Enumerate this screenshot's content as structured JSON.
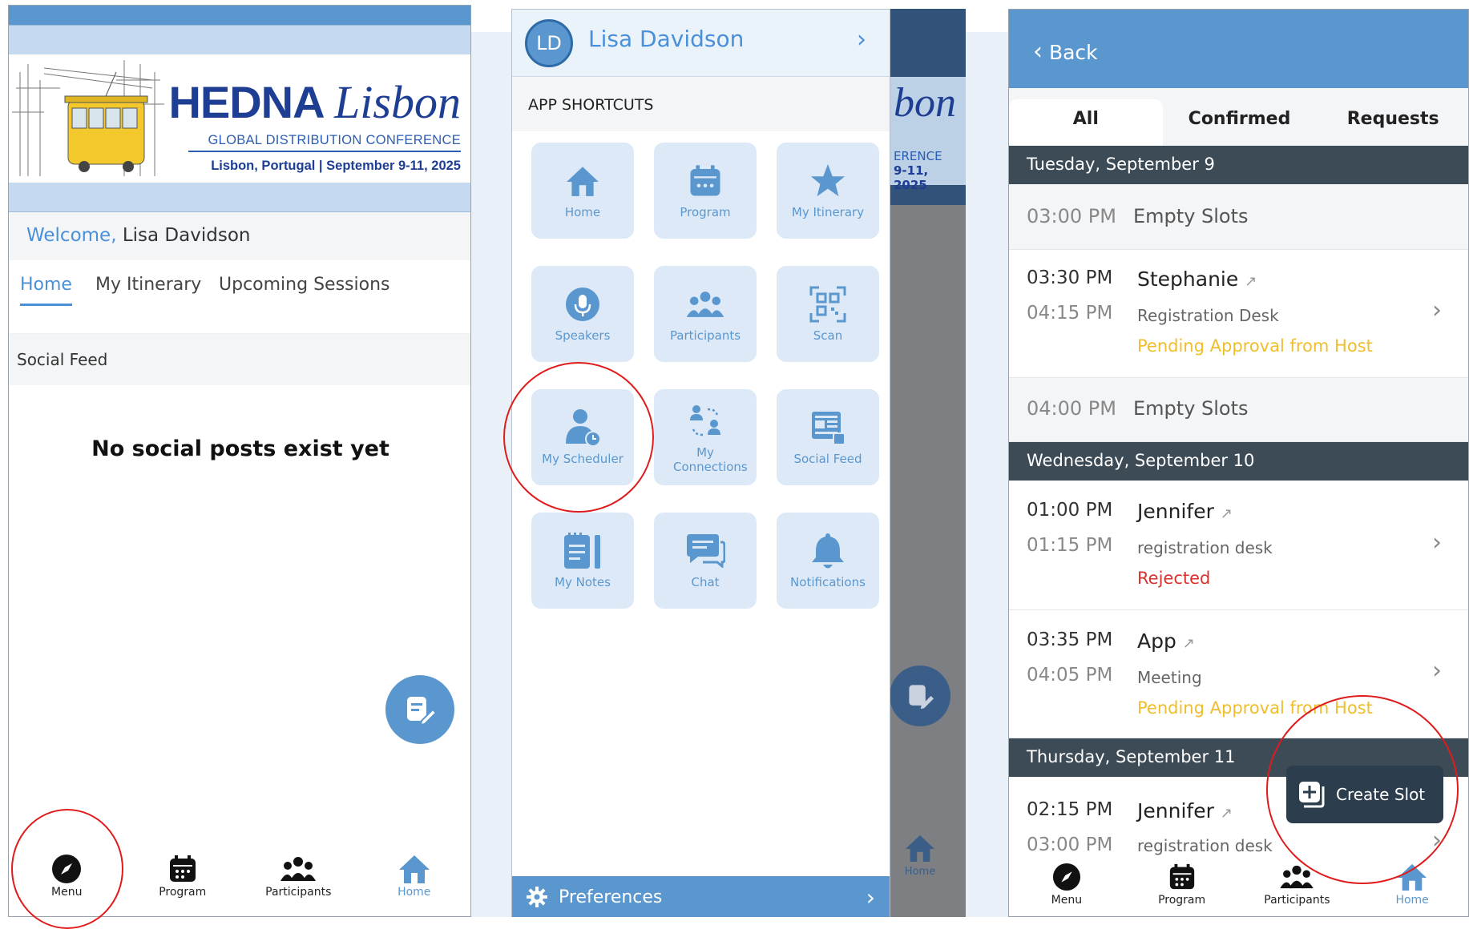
{
  "screen1": {
    "banner": {
      "brand": "HEDNA",
      "city": "Lisbon",
      "subtitle": "GLOBAL DISTRIBUTION CONFERENCE",
      "location_date": "Lisbon, Portugal | September 9-11, 2025"
    },
    "welcome_prefix": "Welcome,",
    "welcome_name": "Lisa Davidson",
    "tabs": [
      "Home",
      "My Itinerary",
      "Upcoming Sessions"
    ],
    "social_feed_label": "Social Feed",
    "empty_message": "No social posts exist yet",
    "nav": [
      "Menu",
      "Program",
      "Participants",
      "Home"
    ]
  },
  "screen2": {
    "avatar_initials": "LD",
    "user_name": "Lisa Davidson",
    "section_title": "APP SHORTCUTS",
    "shortcuts": [
      {
        "label": "Home",
        "icon": "home-icon"
      },
      {
        "label": "Program",
        "icon": "calendar-icon"
      },
      {
        "label": "My Itinerary",
        "icon": "star-icon"
      },
      {
        "label": "Speakers",
        "icon": "microphone-icon"
      },
      {
        "label": "Participants",
        "icon": "people-icon"
      },
      {
        "label": "Scan",
        "icon": "qr-icon"
      },
      {
        "label": "My Scheduler",
        "icon": "person-clock-icon"
      },
      {
        "label": "My Connections",
        "icon": "connections-icon"
      },
      {
        "label": "Social Feed",
        "icon": "social-feed-icon"
      },
      {
        "label": "My Notes",
        "icon": "notes-icon"
      },
      {
        "label": "Chat",
        "icon": "chat-icon"
      },
      {
        "label": "Notifications",
        "icon": "bell-icon"
      }
    ],
    "background_fragment": {
      "city": "bon",
      "subtitle": "ERENCE",
      "date": "9-11, 2025",
      "home": "Home"
    },
    "preferences_label": "Preferences"
  },
  "screen3": {
    "back_label": "Back",
    "tabs": [
      "All",
      "Confirmed",
      "Requests"
    ],
    "days": [
      {
        "header": "Tuesday, September 9"
      },
      {
        "header": "Wednesday, September 10"
      },
      {
        "header": "Thursday, September 11"
      }
    ],
    "slots": [
      {
        "time": "03:00 PM",
        "label": "Empty Slots"
      },
      {
        "start": "03:30 PM",
        "end": "04:15 PM",
        "name": "Stephanie",
        "location": "Registration Desk",
        "status": "Pending Approval from Host"
      },
      {
        "time": "04:00 PM",
        "label": "Empty Slots"
      },
      {
        "start": "01:00 PM",
        "end": "01:15 PM",
        "name": "Jennifer",
        "location": "registration desk",
        "status": "Rejected"
      },
      {
        "start": "03:35 PM",
        "end": "04:05 PM",
        "name": "App",
        "location": "Meeting",
        "status": "Pending Approval from Host"
      },
      {
        "start": "02:15 PM",
        "end": "03:00 PM",
        "name": "Jennifer",
        "location": "registration desk"
      }
    ],
    "create_slot_label": "Create Slot",
    "nav": [
      "Menu",
      "Program",
      "Participants",
      "Home"
    ]
  },
  "colors": {
    "primary": "#5b97cf",
    "dark": "#3d4b57",
    "pending": "#f0be2c",
    "rejected": "#d9322e",
    "highlight": "#e01b1b"
  }
}
